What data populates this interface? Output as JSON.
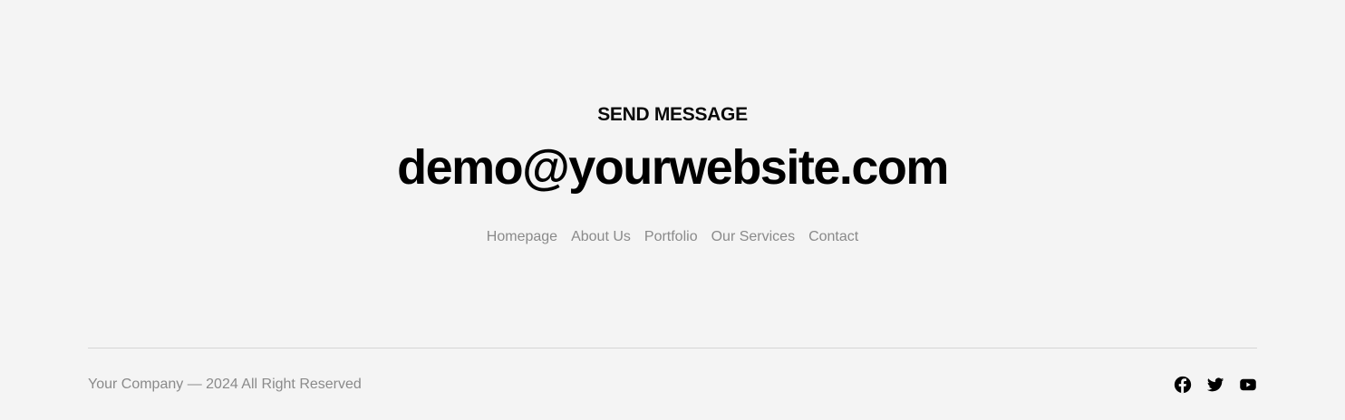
{
  "contact": {
    "eyebrow": "SEND MESSAGE",
    "email": "demo@yourwebsite.com"
  },
  "nav": {
    "items": [
      {
        "label": "Homepage"
      },
      {
        "label": "About Us"
      },
      {
        "label": "Portfolio"
      },
      {
        "label": "Our Services"
      },
      {
        "label": "Contact"
      }
    ]
  },
  "footer": {
    "copyright": "Your Company — 2024 All Right Reserved",
    "social": [
      {
        "icon": "facebook-icon"
      },
      {
        "icon": "twitter-icon"
      },
      {
        "icon": "youtube-icon"
      }
    ]
  },
  "colors": {
    "background": "#f4f4f4",
    "text_primary": "#000000",
    "text_muted": "#8a8a8a",
    "divider": "#d6d6d6"
  }
}
